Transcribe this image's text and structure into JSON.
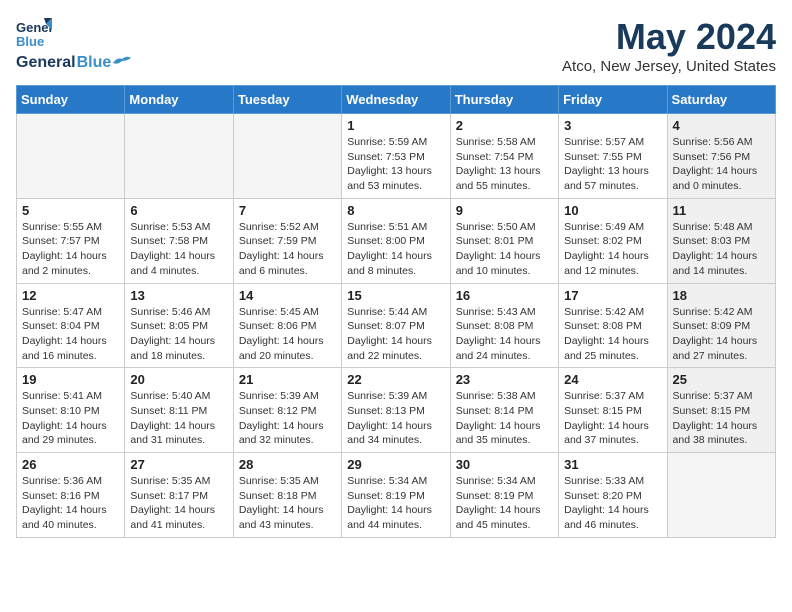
{
  "header": {
    "logo_line1": "General",
    "logo_line2": "Blue",
    "month": "May 2024",
    "location": "Atco, New Jersey, United States"
  },
  "weekdays": [
    "Sunday",
    "Monday",
    "Tuesday",
    "Wednesday",
    "Thursday",
    "Friday",
    "Saturday"
  ],
  "weeks": [
    [
      {
        "day": "",
        "info": "",
        "shade": "empty"
      },
      {
        "day": "",
        "info": "",
        "shade": "empty"
      },
      {
        "day": "",
        "info": "",
        "shade": "empty"
      },
      {
        "day": "1",
        "info": "Sunrise: 5:59 AM\nSunset: 7:53 PM\nDaylight: 13 hours\nand 53 minutes.",
        "shade": ""
      },
      {
        "day": "2",
        "info": "Sunrise: 5:58 AM\nSunset: 7:54 PM\nDaylight: 13 hours\nand 55 minutes.",
        "shade": ""
      },
      {
        "day": "3",
        "info": "Sunrise: 5:57 AM\nSunset: 7:55 PM\nDaylight: 13 hours\nand 57 minutes.",
        "shade": ""
      },
      {
        "day": "4",
        "info": "Sunrise: 5:56 AM\nSunset: 7:56 PM\nDaylight: 14 hours\nand 0 minutes.",
        "shade": "shaded"
      }
    ],
    [
      {
        "day": "5",
        "info": "Sunrise: 5:55 AM\nSunset: 7:57 PM\nDaylight: 14 hours\nand 2 minutes.",
        "shade": ""
      },
      {
        "day": "6",
        "info": "Sunrise: 5:53 AM\nSunset: 7:58 PM\nDaylight: 14 hours\nand 4 minutes.",
        "shade": ""
      },
      {
        "day": "7",
        "info": "Sunrise: 5:52 AM\nSunset: 7:59 PM\nDaylight: 14 hours\nand 6 minutes.",
        "shade": ""
      },
      {
        "day": "8",
        "info": "Sunrise: 5:51 AM\nSunset: 8:00 PM\nDaylight: 14 hours\nand 8 minutes.",
        "shade": ""
      },
      {
        "day": "9",
        "info": "Sunrise: 5:50 AM\nSunset: 8:01 PM\nDaylight: 14 hours\nand 10 minutes.",
        "shade": ""
      },
      {
        "day": "10",
        "info": "Sunrise: 5:49 AM\nSunset: 8:02 PM\nDaylight: 14 hours\nand 12 minutes.",
        "shade": ""
      },
      {
        "day": "11",
        "info": "Sunrise: 5:48 AM\nSunset: 8:03 PM\nDaylight: 14 hours\nand 14 minutes.",
        "shade": "shaded"
      }
    ],
    [
      {
        "day": "12",
        "info": "Sunrise: 5:47 AM\nSunset: 8:04 PM\nDaylight: 14 hours\nand 16 minutes.",
        "shade": ""
      },
      {
        "day": "13",
        "info": "Sunrise: 5:46 AM\nSunset: 8:05 PM\nDaylight: 14 hours\nand 18 minutes.",
        "shade": ""
      },
      {
        "day": "14",
        "info": "Sunrise: 5:45 AM\nSunset: 8:06 PM\nDaylight: 14 hours\nand 20 minutes.",
        "shade": ""
      },
      {
        "day": "15",
        "info": "Sunrise: 5:44 AM\nSunset: 8:07 PM\nDaylight: 14 hours\nand 22 minutes.",
        "shade": ""
      },
      {
        "day": "16",
        "info": "Sunrise: 5:43 AM\nSunset: 8:08 PM\nDaylight: 14 hours\nand 24 minutes.",
        "shade": ""
      },
      {
        "day": "17",
        "info": "Sunrise: 5:42 AM\nSunset: 8:08 PM\nDaylight: 14 hours\nand 25 minutes.",
        "shade": ""
      },
      {
        "day": "18",
        "info": "Sunrise: 5:42 AM\nSunset: 8:09 PM\nDaylight: 14 hours\nand 27 minutes.",
        "shade": "shaded"
      }
    ],
    [
      {
        "day": "19",
        "info": "Sunrise: 5:41 AM\nSunset: 8:10 PM\nDaylight: 14 hours\nand 29 minutes.",
        "shade": ""
      },
      {
        "day": "20",
        "info": "Sunrise: 5:40 AM\nSunset: 8:11 PM\nDaylight: 14 hours\nand 31 minutes.",
        "shade": ""
      },
      {
        "day": "21",
        "info": "Sunrise: 5:39 AM\nSunset: 8:12 PM\nDaylight: 14 hours\nand 32 minutes.",
        "shade": ""
      },
      {
        "day": "22",
        "info": "Sunrise: 5:39 AM\nSunset: 8:13 PM\nDaylight: 14 hours\nand 34 minutes.",
        "shade": ""
      },
      {
        "day": "23",
        "info": "Sunrise: 5:38 AM\nSunset: 8:14 PM\nDaylight: 14 hours\nand 35 minutes.",
        "shade": ""
      },
      {
        "day": "24",
        "info": "Sunrise: 5:37 AM\nSunset: 8:15 PM\nDaylight: 14 hours\nand 37 minutes.",
        "shade": ""
      },
      {
        "day": "25",
        "info": "Sunrise: 5:37 AM\nSunset: 8:15 PM\nDaylight: 14 hours\nand 38 minutes.",
        "shade": "shaded"
      }
    ],
    [
      {
        "day": "26",
        "info": "Sunrise: 5:36 AM\nSunset: 8:16 PM\nDaylight: 14 hours\nand 40 minutes.",
        "shade": ""
      },
      {
        "day": "27",
        "info": "Sunrise: 5:35 AM\nSunset: 8:17 PM\nDaylight: 14 hours\nand 41 minutes.",
        "shade": ""
      },
      {
        "day": "28",
        "info": "Sunrise: 5:35 AM\nSunset: 8:18 PM\nDaylight: 14 hours\nand 43 minutes.",
        "shade": ""
      },
      {
        "day": "29",
        "info": "Sunrise: 5:34 AM\nSunset: 8:19 PM\nDaylight: 14 hours\nand 44 minutes.",
        "shade": ""
      },
      {
        "day": "30",
        "info": "Sunrise: 5:34 AM\nSunset: 8:19 PM\nDaylight: 14 hours\nand 45 minutes.",
        "shade": ""
      },
      {
        "day": "31",
        "info": "Sunrise: 5:33 AM\nSunset: 8:20 PM\nDaylight: 14 hours\nand 46 minutes.",
        "shade": ""
      },
      {
        "day": "",
        "info": "",
        "shade": "empty"
      }
    ]
  ]
}
